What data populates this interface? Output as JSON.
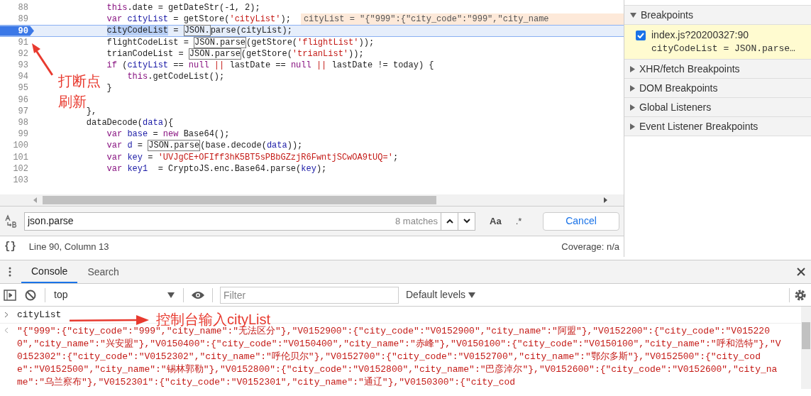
{
  "editor": {
    "lines": [
      {
        "number": "88",
        "current": false,
        "tokens": [
          {
            "text": "        this",
            "kind": "keyword"
          },
          {
            "text": ".date = getDateStr(-1, 2);",
            "kind": "plain"
          }
        ]
      },
      {
        "number": "89",
        "current": false,
        "tokens": [
          {
            "text": "        var",
            "kind": "keyword"
          },
          {
            "text": " cityList",
            "kind": "variable"
          },
          {
            "text": " = getStore(",
            "kind": "plain"
          },
          {
            "text": "'cityList'",
            "kind": "string"
          },
          {
            "text": ");",
            "kind": "plain"
          }
        ],
        "inline_value": "cityList = \"{\"999\":{\"city_code\":\"999\",\"city_name"
      },
      {
        "number": "90",
        "current": true,
        "tokens": [
          {
            "text": "        cityCodeList",
            "kind": "paused"
          },
          {
            "text": " = ",
            "kind": "plain"
          },
          {
            "text": "JSON.",
            "kind": "match"
          },
          {
            "text": "parse(cityList);",
            "kind": "plain"
          }
        ]
      },
      {
        "number": "91",
        "current": false,
        "tokens": [
          {
            "text": "        flightCodeList = ",
            "kind": "plain"
          },
          {
            "text": "JSON.parse",
            "kind": "match"
          },
          {
            "text": "(getStore(",
            "kind": "plain"
          },
          {
            "text": "'flightList'",
            "kind": "string"
          },
          {
            "text": "));",
            "kind": "plain"
          }
        ]
      },
      {
        "number": "92",
        "current": false,
        "tokens": [
          {
            "text": "        trianCodeList = ",
            "kind": "plain"
          },
          {
            "text": "JSON.parse",
            "kind": "match"
          },
          {
            "text": "(getStore(",
            "kind": "plain"
          },
          {
            "text": "'trianList'",
            "kind": "string"
          },
          {
            "text": "));",
            "kind": "plain"
          }
        ]
      },
      {
        "number": "93",
        "current": false,
        "tokens": [
          {
            "text": "        if",
            "kind": "keyword"
          },
          {
            "text": " (",
            "kind": "plain"
          },
          {
            "text": "cityList",
            "kind": "variable"
          },
          {
            "text": " == ",
            "kind": "plain"
          },
          {
            "text": "null",
            "kind": "keyword"
          },
          {
            "text": " ||",
            "kind": "string"
          },
          {
            "text": " lastDate == ",
            "kind": "plain"
          },
          {
            "text": "null",
            "kind": "keyword"
          },
          {
            "text": " ||",
            "kind": "string"
          },
          {
            "text": " lastDate != today) {",
            "kind": "plain"
          }
        ]
      },
      {
        "number": "94",
        "current": false,
        "tokens": [
          {
            "text": "            this",
            "kind": "keyword"
          },
          {
            "text": ".getCodeList();",
            "kind": "plain"
          }
        ]
      },
      {
        "number": "95",
        "current": false,
        "tokens": [
          {
            "text": "        }",
            "kind": "plain"
          }
        ]
      },
      {
        "number": "96",
        "current": false
      },
      {
        "number": "97",
        "current": false,
        "tokens": [
          {
            "text": "    },",
            "kind": "plain"
          }
        ]
      },
      {
        "number": "98",
        "current": false,
        "tokens": [
          {
            "text": "    dataDecode(",
            "kind": "plain"
          },
          {
            "text": "data",
            "kind": "variable"
          },
          {
            "text": "){",
            "kind": "plain"
          }
        ]
      },
      {
        "number": "99",
        "current": false,
        "tokens": [
          {
            "text": "        var",
            "kind": "keyword"
          },
          {
            "text": " base",
            "kind": "variable"
          },
          {
            "text": " = ",
            "kind": "plain"
          },
          {
            "text": "new",
            "kind": "keyword"
          },
          {
            "text": " Base64();",
            "kind": "plain"
          }
        ]
      },
      {
        "number": "100",
        "current": false,
        "tokens": [
          {
            "text": "        var",
            "kind": "keyword"
          },
          {
            "text": " d",
            "kind": "variable"
          },
          {
            "text": " = ",
            "kind": "plain"
          },
          {
            "text": "JSON.parse",
            "kind": "match"
          },
          {
            "text": "(base.decode(",
            "kind": "plain"
          },
          {
            "text": "data",
            "kind": "variable"
          },
          {
            "text": "));",
            "kind": "plain"
          }
        ]
      },
      {
        "number": "101",
        "current": false,
        "tokens": [
          {
            "text": "        var",
            "kind": "keyword"
          },
          {
            "text": " key",
            "kind": "variable"
          },
          {
            "text": " = ",
            "kind": "plain"
          },
          {
            "text": "'UVJgCE+OFIff3hK5BT5sPBbGZzjR6FwntjSCwOA9tUQ='",
            "kind": "string"
          },
          {
            "text": ";",
            "kind": "plain"
          }
        ]
      },
      {
        "number": "102",
        "current": false,
        "tokens": [
          {
            "text": "        var",
            "kind": "keyword"
          },
          {
            "text": " key1",
            "kind": "variable"
          },
          {
            "text": "  = CryptoJS.enc.Base64.parse(",
            "kind": "plain"
          },
          {
            "text": "key",
            "kind": "variable"
          },
          {
            "text": ");",
            "kind": "plain"
          }
        ]
      },
      {
        "number": "103",
        "current": false
      }
    ]
  },
  "sidebar": {
    "sections": [
      {
        "title": "Breakpoints",
        "expanded": true,
        "breakpoints": [
          {
            "file": "index.js?20200327:90",
            "code": "cityCodeList = JSON.parse…",
            "checked": true
          }
        ]
      },
      {
        "title": "XHR/fetch Breakpoints",
        "expanded": false
      },
      {
        "title": "DOM Breakpoints",
        "expanded": false
      },
      {
        "title": "Global Listeners",
        "expanded": false
      },
      {
        "title": "Event Listener Breakpoints",
        "expanded": false
      }
    ]
  },
  "search_bar": {
    "value": "json.parse",
    "matches": "8 matches",
    "case_button": "Aa",
    "regex_button": ".*",
    "cancel": "Cancel"
  },
  "status_bar": {
    "format_button": "{}",
    "position": "Line 90, Column 13",
    "coverage": "Coverage: n/a"
  },
  "drawer_tabs": [
    {
      "label": "Console",
      "selected": true
    },
    {
      "label": "Search",
      "selected": false
    }
  ],
  "console_toolbar": {
    "context": "top",
    "filter_placeholder": "Filter",
    "levels": "Default levels"
  },
  "console": {
    "input": "cityList",
    "output": "\"{\"999\":{\"city_code\":\"999\",\"city_name\":\"无法区分\"},\"V0152900\":{\"city_code\":\"V0152900\",\"city_name\":\"阿盟\"},\"V0152200\":{\"city_code\":\"V0152200\",\"city_name\":\"兴安盟\"},\"V0150400\":{\"city_code\":\"V0150400\",\"city_name\":\"赤峰\"},\"V0150100\":{\"city_code\":\"V0150100\",\"city_name\":\"呼和浩特\"},\"V0152302\":{\"city_code\":\"V0152302\",\"city_name\":\"呼伦贝尔\"},\"V0152700\":{\"city_code\":\"V0152700\",\"city_name\":\"鄂尔多斯\"},\"V0152500\":{\"city_code\":\"V0152500\",\"city_name\":\"锡林郭勒\"},\"V0152800\":{\"city_code\":\"V0152800\",\"city_name\":\"巴彦淖尔\"},\"V0152600\":{\"city_code\":\"V0152600\",\"city_name\":\"乌兰察布\"},\"V0152301\":{\"city_code\":\"V0152301\",\"city_name\":\"通辽\"},\"V0150300\":{\"city_cod"
  },
  "annotations": [
    {
      "text": "打断点"
    },
    {
      "text": "刷新"
    },
    {
      "text": "控制台输入cityList"
    }
  ]
}
